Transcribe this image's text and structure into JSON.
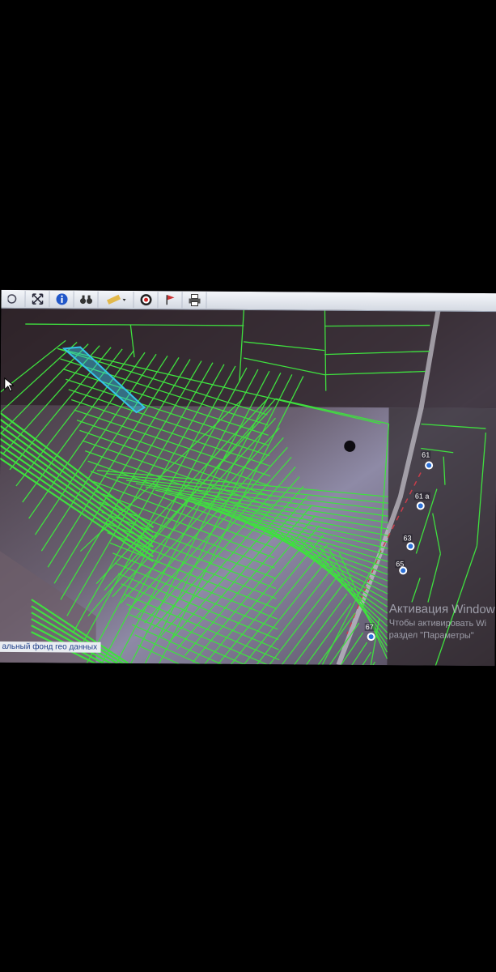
{
  "toolbar": {
    "tools": [
      {
        "name": "zoom-extent-icon"
      },
      {
        "name": "fullscreen-icon"
      },
      {
        "name": "info-icon"
      },
      {
        "name": "binoculars-icon"
      },
      {
        "name": "ruler-icon"
      },
      {
        "name": "target-icon"
      },
      {
        "name": "flag-icon"
      },
      {
        "name": "print-icon"
      }
    ]
  },
  "map": {
    "source_label": "альный фонд гео данных",
    "plot_labels": [
      "61",
      "61 а",
      "63",
      "65",
      "67"
    ]
  },
  "activation": {
    "title": "Активация Window",
    "line1": "Чтобы активировать Wi",
    "line2": "раздел \"Параметры\""
  },
  "colors": {
    "parcel_line": "#3fe03f",
    "selected_parcel": "#35c4e8",
    "toolbar_bg": "#dde2ea"
  }
}
